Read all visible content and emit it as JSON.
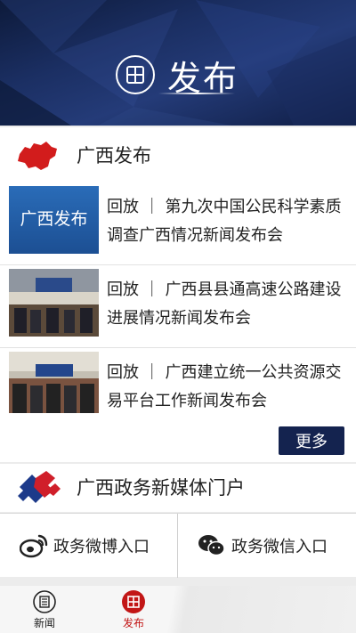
{
  "banner": {
    "title": "发布",
    "icon": "grid-icon"
  },
  "section_release": {
    "title": "广西发布",
    "icon": "guangxi-map-icon",
    "thumb0_logo": "广西发布"
  },
  "news": [
    {
      "text": "回放 ｜ 第九次中国公民科学素质调查广西情况新闻发布会"
    },
    {
      "text": "回放 ｜ 广西县县通高速公路建设进展情况新闻发布会"
    },
    {
      "text": "回放 ｜ 广西建立统一公共资源交易平台工作新闻发布会"
    }
  ],
  "more_label": "更多",
  "section_portal": {
    "title": "广西政务新媒体门户",
    "icon": "puzzle-icon"
  },
  "portals": {
    "weibo": {
      "label": "政务微博入口",
      "icon": "weibo-icon"
    },
    "wechat": {
      "label": "政务微信入口",
      "icon": "wechat-icon"
    }
  },
  "tabs": [
    {
      "label": "新闻",
      "icon": "newspaper-icon"
    },
    {
      "label": "发布",
      "icon": "grid-icon"
    }
  ],
  "colors": {
    "accent_red": "#c21616",
    "navy": "#14234f"
  }
}
